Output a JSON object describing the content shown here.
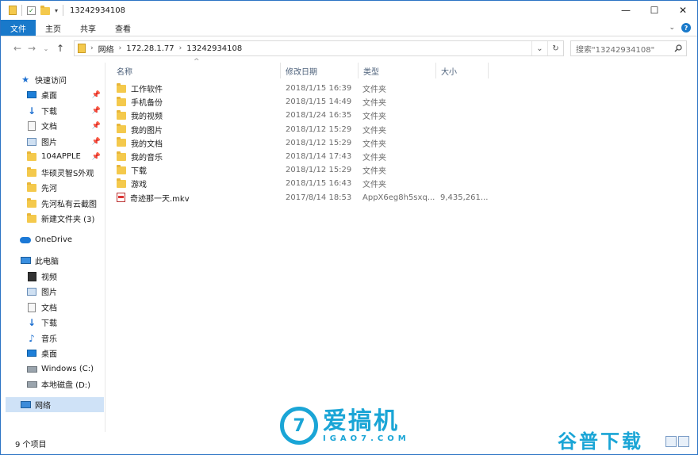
{
  "window": {
    "title": "13242934108",
    "controls": {
      "minimize": "—",
      "maximize": "☐",
      "close": "✕"
    }
  },
  "ribbon": {
    "tabs": [
      "文件",
      "主页",
      "共享",
      "查看"
    ],
    "help": "?"
  },
  "address": {
    "crumbs": [
      "网络",
      "172.28.1.77",
      "13242934108"
    ],
    "search_placeholder": "搜索\"13242934108\""
  },
  "sidebar": {
    "quick_access": "快速访问",
    "quick_items": [
      "桌面",
      "下载",
      "文档",
      "图片",
      "104APPLE",
      "华硕灵智S外观",
      "先河",
      "先河私有云截图",
      "新建文件夹 (3)"
    ],
    "onedrive": "OneDrive",
    "this_pc": "此电脑",
    "pc_items": [
      "视频",
      "图片",
      "文档",
      "下载",
      "音乐",
      "桌面",
      "Windows (C:)",
      "本地磁盘 (D:)"
    ],
    "network": "网络"
  },
  "columns": {
    "name": "名称",
    "date": "修改日期",
    "type": "类型",
    "size": "大小"
  },
  "files": [
    {
      "name": "工作软件",
      "date": "2018/1/15 16:39",
      "type": "文件夹",
      "size": "",
      "kind": "folder"
    },
    {
      "name": "手机备份",
      "date": "2018/1/15 14:49",
      "type": "文件夹",
      "size": "",
      "kind": "folder"
    },
    {
      "name": "我的视频",
      "date": "2018/1/24 16:35",
      "type": "文件夹",
      "size": "",
      "kind": "folder"
    },
    {
      "name": "我的图片",
      "date": "2018/1/12 15:29",
      "type": "文件夹",
      "size": "",
      "kind": "folder"
    },
    {
      "name": "我的文档",
      "date": "2018/1/12 15:29",
      "type": "文件夹",
      "size": "",
      "kind": "folder"
    },
    {
      "name": "我的音乐",
      "date": "2018/1/14 17:43",
      "type": "文件夹",
      "size": "",
      "kind": "folder"
    },
    {
      "name": "下载",
      "date": "2018/1/12 15:29",
      "type": "文件夹",
      "size": "",
      "kind": "folder"
    },
    {
      "name": "游戏",
      "date": "2018/1/15 16:43",
      "type": "文件夹",
      "size": "",
      "kind": "folder"
    },
    {
      "name": "奇迹那一天.mkv",
      "date": "2017/8/14 18:53",
      "type": "AppX6eg8h5sxq...",
      "size": "9,435,261...",
      "kind": "mkv"
    }
  ],
  "status": {
    "item_count": "9 个项目"
  },
  "watermarks": {
    "brand_cn": "爱搞机",
    "brand_en": "IGAO7.COM",
    "logo_char": "7",
    "site2": "谷普下载"
  }
}
